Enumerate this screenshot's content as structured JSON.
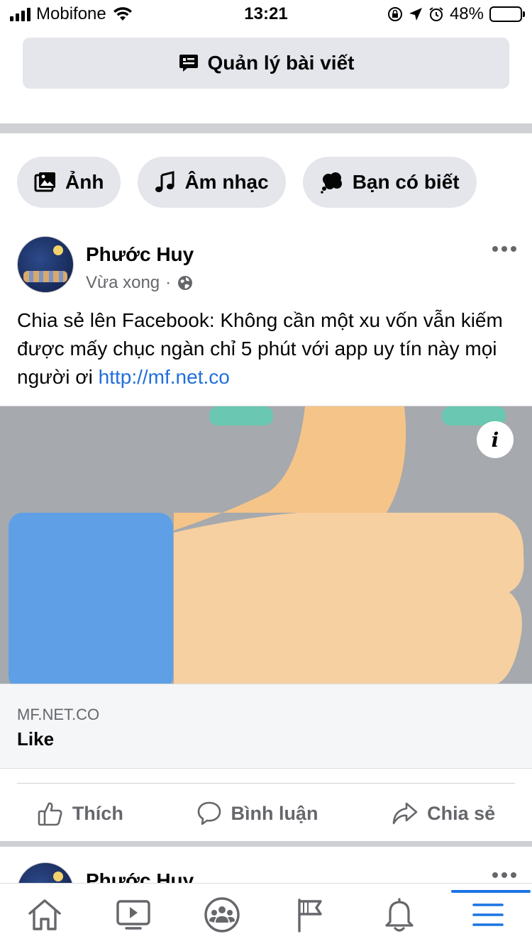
{
  "status_bar": {
    "carrier": "Mobifone",
    "time": "13:21",
    "battery_percent": "48%",
    "battery_level": 0.48
  },
  "manage_posts": {
    "label": "Quản lý bài viết"
  },
  "chips": [
    {
      "label": "Ảnh",
      "icon": "photo-icon"
    },
    {
      "label": "Âm nhạc",
      "icon": "music-note-icon"
    },
    {
      "label": "Bạn có biết",
      "icon": "thought-bubble-icon"
    }
  ],
  "post": {
    "author": "Phước Huy",
    "time": "Vừa xong",
    "separator": "·",
    "privacy_icon": "globe-icon",
    "text": "Chia sẻ lên Facebook: Không cần một xu vốn vẫn kiếm được mấy chục ngàn chỉ 5 phút với app uy tín này mọi người ơi ",
    "link_text": "http://mf.net.co",
    "preview": {
      "domain": "MF.NET.CO",
      "title": "Like"
    },
    "actions": {
      "like": "Thích",
      "comment": "Bình luận",
      "share": "Chia sẻ"
    }
  },
  "next_post": {
    "author": "Phước Huy"
  },
  "colors": {
    "accent": "#1b74e4",
    "link": "#216fdb",
    "chip_bg": "#e4e6eb",
    "muted": "#65676b"
  },
  "tabbar": {
    "items": [
      "home-icon",
      "video-icon",
      "groups-icon",
      "pages-flag-icon",
      "notifications-bell-icon",
      "menu-icon"
    ],
    "active": "menu-icon"
  }
}
